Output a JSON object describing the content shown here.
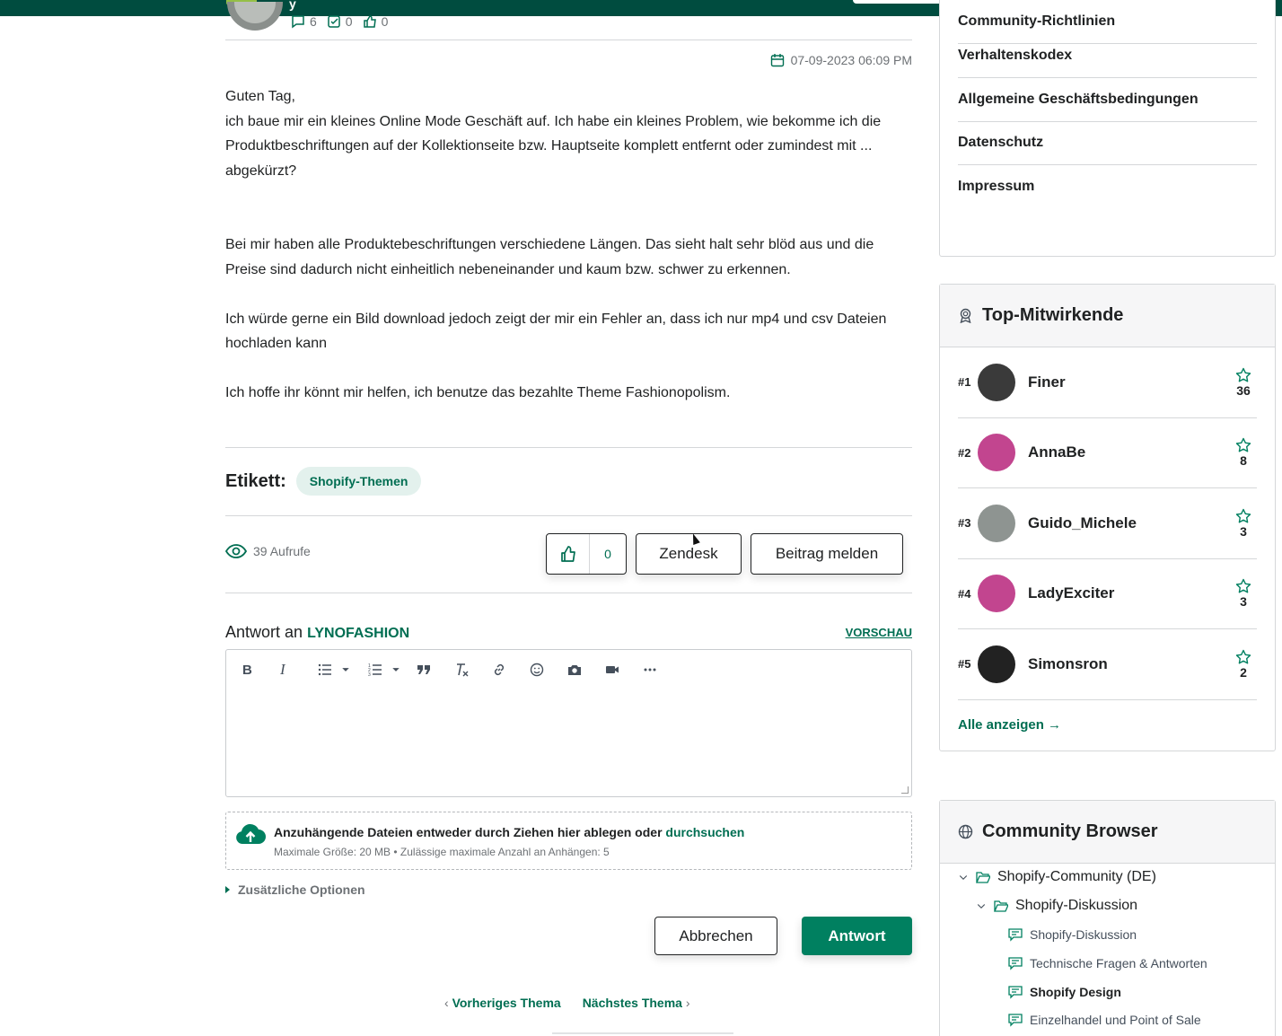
{
  "header": {
    "logo_text": "y"
  },
  "post": {
    "stats": {
      "replies": "6",
      "solutions": "0",
      "likes": "0"
    },
    "date": "07-09-2023 06:09 PM",
    "paragraphs": [
      "Guten Tag,",
      "ich baue mir ein kleines Online Mode Geschäft auf. Ich habe ein kleines Problem, wie bekomme ich die Produktbeschriftungen auf der Kollektionseite bzw. Hauptseite komplett entfernt oder zumindest mit ... abgekürzt?",
      "Bei mir haben alle Produktebeschriftungen verschiedene Längen. Das sieht halt sehr blöd aus und die Preise sind dadurch nicht einheitlich nebeneinander und kaum bzw. schwer zu erkennen.",
      "Ich würde gerne ein Bild download jedoch zeigt der mir ein Fehler an, dass ich nur mp4 und csv Dateien hochladen kann",
      "Ich hoffe ihr könnt mir helfen, ich benutze das bezahlte Theme Fashionopolism."
    ],
    "tags_label": "Etikett:",
    "tag": "Shopify-Themen",
    "views": "39 Aufrufe",
    "like_count": "0",
    "zendesk_label": "Zendesk",
    "report_label": "Beitrag melden"
  },
  "reply": {
    "prefix": "Antwort an",
    "user": "LYNOFASHION",
    "preview_label": "VORSCHAU",
    "toolbar": {
      "bold": "B",
      "italic": "I"
    },
    "dropzone_text": "Anzuhängende Dateien entweder durch Ziehen hier ablegen oder",
    "dropzone_browse": "durchsuchen",
    "dropzone_limits": "Maximale Größe: 20 MB • Zulässige maximale Anzahl an Anhängen: 5",
    "extra_options": "Zusätzliche Optionen",
    "cancel_label": "Abbrechen",
    "submit_label": "Antwort"
  },
  "thread_nav": {
    "prev": "Vorheriges Thema",
    "next": "Nächstes Thema",
    "prev_arrow": "‹",
    "next_arrow": "›"
  },
  "sidebar": {
    "links": [
      "Community-Richtlinien",
      "Verhaltenskodex",
      "Allgemeine Geschäftsbedingungen",
      "Datenschutz",
      "Impressum"
    ],
    "top_contributors": {
      "title": "Top-Mitwirkende",
      "items": [
        {
          "rank": "#1",
          "name": "Finer",
          "kudos": "36",
          "avatar_color": "#3a3a3a"
        },
        {
          "rank": "#2",
          "name": "AnnaBe",
          "kudos": "8",
          "avatar_color": "#c2458f"
        },
        {
          "rank": "#3",
          "name": "Guido_Michele",
          "kudos": "3",
          "avatar_color": "#8e9491"
        },
        {
          "rank": "#4",
          "name": "LadyExciter",
          "kudos": "3",
          "avatar_color": "#c2458f"
        },
        {
          "rank": "#5",
          "name": "Simonsron",
          "kudos": "2",
          "avatar_color": "#222222"
        }
      ],
      "see_all": "Alle anzeigen →"
    },
    "community_browser": {
      "title": "Community Browser",
      "tree": [
        {
          "label": "Shopify-Community (DE)"
        },
        {
          "label": "Shopify-Diskussion"
        },
        {
          "label": "Shopify-Diskussion"
        },
        {
          "label": "Technische Fragen & Antworten"
        },
        {
          "label": "Shopify Design"
        },
        {
          "label": "Einzelhandel und Point of Sale"
        }
      ]
    }
  },
  "colors": {
    "brand_green": "#008060",
    "link_green": "#006e52",
    "header_bg": "#004c3f"
  }
}
